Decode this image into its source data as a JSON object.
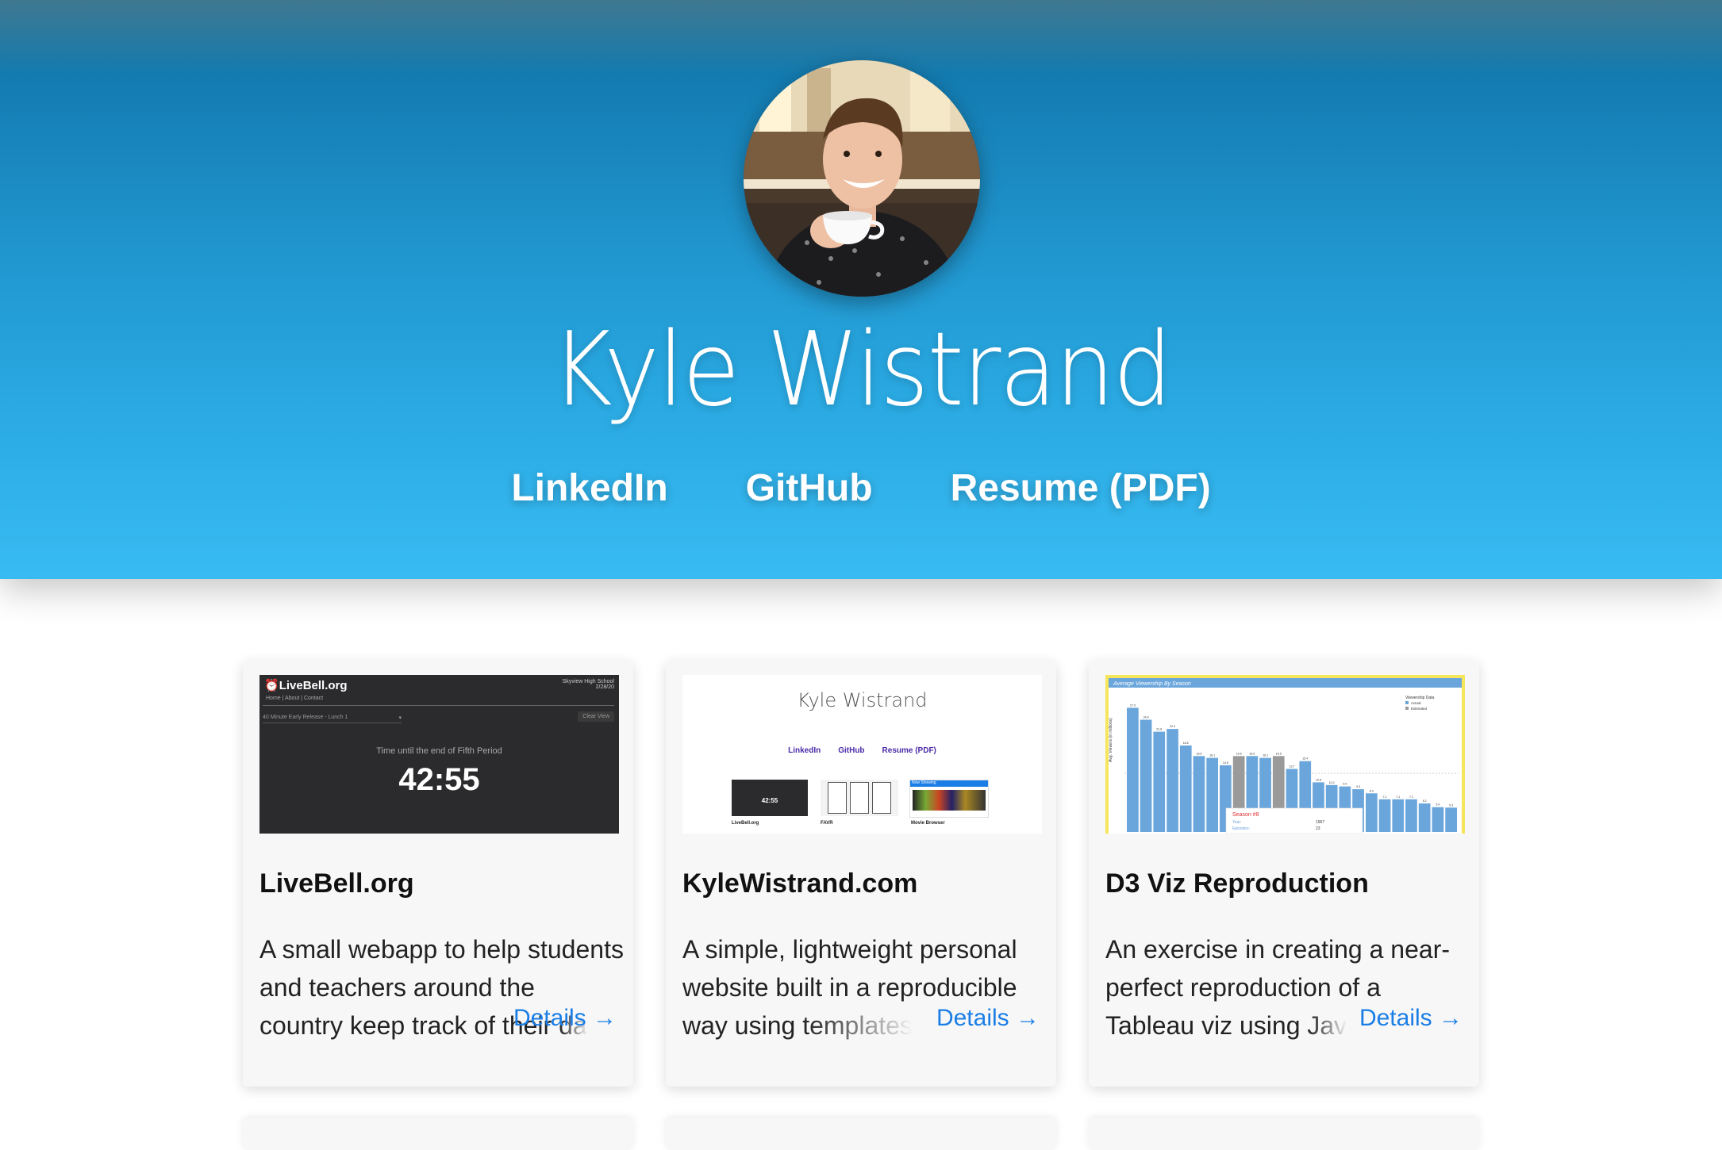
{
  "header": {
    "name": "Kyle Wistrand",
    "links": [
      "LinkedIn",
      "GitHub",
      "Resume (PDF)"
    ]
  },
  "projects": [
    {
      "title": "LiveBell.org",
      "description_visible": "A small webapp to help students and teachers around the country keep track of their",
      "description_faded": "da",
      "details": "Details →",
      "thumb": {
        "logo": "LiveBell.org",
        "nav": "Home  |  About  |  Contact",
        "school": "Skyview High School",
        "date": "2/28/20",
        "schedule": "40 Minute Early Release - Lunch 1",
        "button": "Clear View",
        "caption": "Time until the end of Fifth Period",
        "timer": "42:55"
      }
    },
    {
      "title": "KyleWistrand.com",
      "description_visible": "A simple, lightweight personal website built in a reproducible way using",
      "description_faded": "templates",
      "details": "Details →",
      "thumb": {
        "name": "Kyle Wistrand",
        "links": [
          "LinkedIn",
          "GitHub",
          "Resume (PDF)"
        ],
        "timer": "42:55",
        "captions": [
          "LiveBell.org",
          "FAVR",
          "Movie Browser"
        ],
        "movie_header": "Now Showing"
      }
    },
    {
      "title": "D3 Viz Reproduction",
      "description_visible": "An exercise in creating a near-perfect reproduction of a Tableau viz using",
      "description_faded": "Jav",
      "details": "Details →",
      "thumb": {
        "chart_title": "Average Viewership By Season",
        "legend_title": "Viewership Data",
        "legend": [
          "Actual",
          "Estimated"
        ],
        "tooltip_title": "Season #8",
        "tooltip_labels": [
          "Year:",
          "Episodes:"
        ],
        "tooltip_values": [
          "1967",
          "23"
        ],
        "ylabel": "Avg. Viewers (in millions)",
        "bar_values": [
          27.0,
          24.4,
          21.8,
          22.4,
          18.8,
          16.5,
          16.1,
          14.5,
          16.5,
          16.5,
          16.1,
          16.5,
          13.7,
          15.4,
          10.8,
          10.2,
          9.9,
          9.3,
          8.4,
          7.1,
          7.1,
          7.1,
          6.2,
          5.4,
          5.3
        ],
        "estimated_indices": [
          8,
          11
        ],
        "highlight": "#f7e55a",
        "bar_color": "#6aa6dc",
        "estimated_color": "#9a9a9a"
      }
    }
  ],
  "colors": {
    "link": "#1a7ee6",
    "hero_top": "#137bb0",
    "hero_bottom": "#38bbf2"
  }
}
